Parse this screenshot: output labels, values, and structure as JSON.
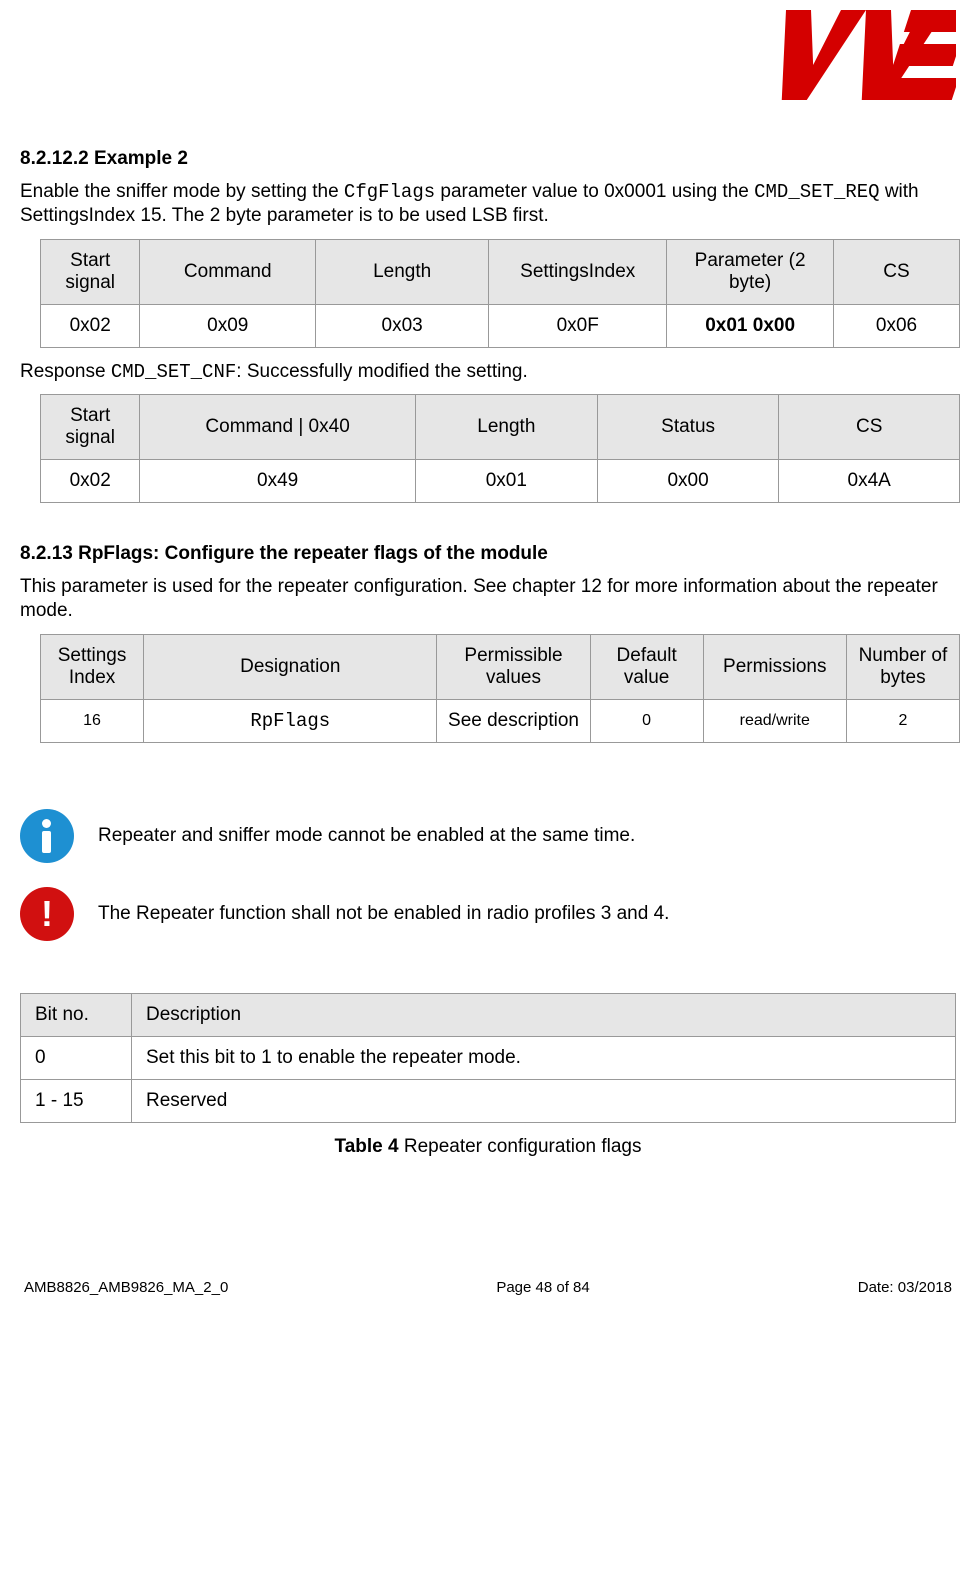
{
  "header": {
    "logo_alt": "WE logo"
  },
  "section1": {
    "heading": "8.2.12.2 Example 2",
    "para_prefix": "Enable the sniffer mode by setting the ",
    "para_code1": "CfgFlags",
    "para_mid": " parameter value to 0x0001 using the ",
    "para_code2": "CMD_SET_REQ",
    "para_suffix": " with SettingsIndex 15. The 2 byte parameter is to be used LSB first."
  },
  "table1": {
    "headers": [
      "Start signal",
      "Command",
      "Length",
      "SettingsIndex",
      "Parameter (2 byte)",
      "CS"
    ],
    "row": [
      "0x02",
      "0x09",
      "0x03",
      "0x0F",
      "0x01 0x00",
      "0x06"
    ]
  },
  "response_line": {
    "prefix": "Response ",
    "code": "CMD_SET_CNF",
    "suffix": ": Successfully modified the setting."
  },
  "table2": {
    "headers": [
      "Start signal",
      "Command | 0x40",
      "Length",
      "Status",
      "CS"
    ],
    "row": [
      "0x02",
      "0x49",
      "0x01",
      "0x00",
      "0x4A"
    ]
  },
  "section2": {
    "heading": "8.2.13 RpFlags: Configure the repeater flags of the module",
    "para": "This parameter is used for the repeater configuration. See chapter 12 for more information about the repeater mode."
  },
  "table3": {
    "headers": [
      "Settings Index",
      "Designation",
      "Permissible values",
      "Default value",
      "Permissions",
      "Number of bytes"
    ],
    "row": [
      "16",
      "RpFlags",
      "See description",
      "0",
      "read/write",
      "2"
    ]
  },
  "note1": "Repeater and sniffer mode cannot be enabled at the same time.",
  "note2": "The Repeater function shall not be enabled in radio profiles 3 and 4.",
  "table4": {
    "headers": [
      "Bit no.",
      "Description"
    ],
    "rows": [
      [
        "0",
        "Set this bit to 1 to enable the repeater mode."
      ],
      [
        "1 - 15",
        "Reserved"
      ]
    ]
  },
  "table4_caption_bold": "Table 4",
  "table4_caption_rest": " Repeater configuration flags",
  "footer": {
    "left": "AMB8826_AMB9826_MA_2_0",
    "center": "Page 48 of 84",
    "right": "Date: 03/2018"
  }
}
